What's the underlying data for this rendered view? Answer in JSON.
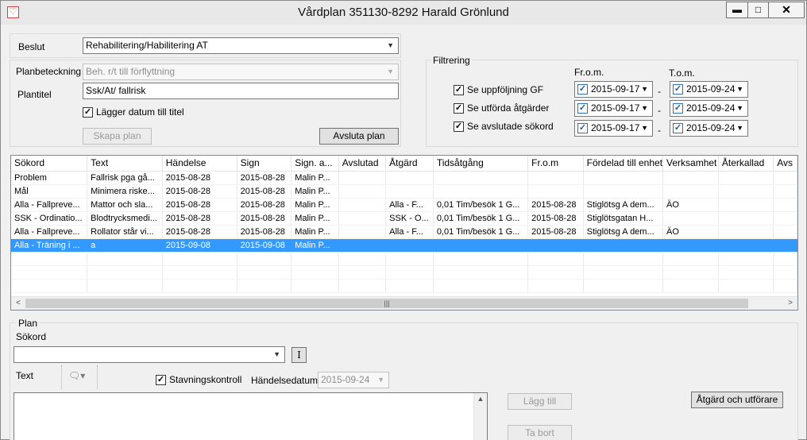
{
  "window": {
    "title": "Vårdplan 351130-8292 Harald Grönlund",
    "icon": "heart-icon",
    "controls": {
      "minimize": "▬",
      "maximize": "□",
      "close": "✕"
    }
  },
  "form": {
    "beslut_label": "Beslut",
    "beslut_value": "Rehabilitering/Habilitering AT",
    "planbeteckning_label": "Planbeteckning",
    "planbeteckning_value": "Beh. r/t till förflyttning",
    "plantitel_label": "Plantitel",
    "plantitel_value": "Ssk/At/ fallrisk",
    "lagger_datum_label": "Lägger datum till titel",
    "lagger_datum_checked": true,
    "skapa_plan": "Skapa plan",
    "avsluta_plan": "Avsluta plan"
  },
  "filter": {
    "title": "Filtrering",
    "from_header": "Fr.o.m.",
    "tom_header": "T.o.m.",
    "dash": "-",
    "rows": [
      {
        "label": "Se uppföljning GF",
        "checked": true,
        "from": "2015-09-17",
        "to": "2015-09-24"
      },
      {
        "label": "Se utförda åtgärder",
        "checked": true,
        "from": "2015-09-17",
        "to": "2015-09-24"
      },
      {
        "label": "Se avslutade sökord",
        "checked": true,
        "from": "2015-09-17",
        "to": "2015-09-24"
      }
    ]
  },
  "grid": {
    "columns": [
      "Sökord",
      "Text",
      "Händelse",
      "Sign",
      "Sign. a...",
      "Avslutad",
      "Åtgärd",
      "Tidsåtgång",
      "Fr.o.m",
      "Fördelad till enhet",
      "Verksamhet",
      "Återkallad",
      "Avs"
    ],
    "rows": [
      [
        "Problem",
        "Fallrisk pga gå...",
        "2015-08-28",
        "2015-08-28",
        "Malin P...",
        "",
        "",
        "",
        "",
        "",
        "",
        "",
        ""
      ],
      [
        "Mål",
        "Minimera riske...",
        "2015-08-28",
        "2015-08-28",
        "Malin P...",
        "",
        "",
        "",
        "",
        "",
        "",
        "",
        ""
      ],
      [
        "Alla - Fallpreve...",
        "Mattor och sla...",
        "2015-08-28",
        "2015-08-28",
        "Malin P...",
        "",
        "Alla - F...",
        "0,01 Tim/besök 1 G...",
        "2015-08-28",
        "Stiglötsg A dem...",
        "ÄO",
        "",
        ""
      ],
      [
        "SSK - Ordinatio...",
        "Blodtrycksmedi...",
        "2015-08-28",
        "2015-08-28",
        "Malin P...",
        "",
        "SSK - O...",
        "0,01 Tim/besök 1 G...",
        "2015-08-28",
        "Stiglötsgatan H...",
        "",
        "",
        ""
      ],
      [
        "Alla - Fallpreve...",
        "Rollator står vi...",
        "2015-08-28",
        "2015-08-28",
        "Malin P...",
        "",
        "Alla - F...",
        "0,01 Tim/besök 1 G...",
        "2015-08-28",
        "Stiglötsg A dem...",
        "ÄO",
        "",
        ""
      ],
      [
        "Alla - Träning i ...",
        "a",
        "2015-09-08",
        "2015-09-08",
        "Malin P...",
        "",
        "",
        "",
        "",
        "",
        "",
        "",
        ""
      ]
    ],
    "selected_row": 5,
    "scroll_left": "<",
    "scroll_right": ">",
    "scroll_grip": "|||"
  },
  "plan": {
    "title": "Plan",
    "sokord_label": "Sökord",
    "sokord_value": "",
    "info_button": "I",
    "text_label": "Text",
    "stavning_label": "Stavningskontroll",
    "stavning_checked": true,
    "handelsedatum_label": "Händelsedatum",
    "handelsedatum_value": "2015-09-24",
    "lagg_till": "Lägg till",
    "ta_bort": "Ta bort",
    "atgard_utforare": "Åtgärd och utförare",
    "text_value": ""
  },
  "colors": {
    "selection": "#3399ff",
    "window_bg": "#f0f0f0"
  }
}
